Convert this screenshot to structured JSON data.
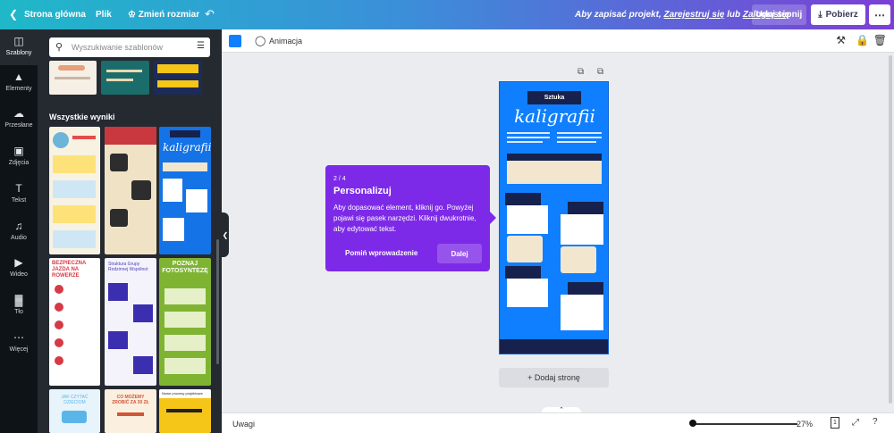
{
  "topbar": {
    "home": "Strona główna",
    "file": "Plik",
    "resize": "Zmień rozmiar",
    "save_prefix": "Aby zapisać projekt,",
    "register": "Zarejestruj się",
    "or": "lub",
    "login": "Zaloguj się",
    "share": "Udostępnij",
    "download": "Pobierz"
  },
  "rail": [
    {
      "label": "Szablony",
      "icon": "templates-icon",
      "active": true
    },
    {
      "label": "Elementy",
      "icon": "elements-icon"
    },
    {
      "label": "Przesłane",
      "icon": "upload-icon"
    },
    {
      "label": "Zdjęcia",
      "icon": "photos-icon"
    },
    {
      "label": "Tekst",
      "icon": "text-icon"
    },
    {
      "label": "Audio",
      "icon": "audio-icon"
    },
    {
      "label": "Wideo",
      "icon": "video-icon"
    },
    {
      "label": "Tło",
      "icon": "background-icon"
    },
    {
      "label": "Więcej",
      "icon": "more-icon"
    }
  ],
  "panel": {
    "search_placeholder": "Wyszukiwanie szablonów",
    "section_title": "Wszystkie wyniki"
  },
  "templates": [
    {
      "title": "BEZPIECZNA JAZDA NA ROWERZE",
      "accent": "#d63a46"
    },
    {
      "title": "Struktura Grupy Rodzinnej Wspólnot",
      "accent": "#4b3fb5"
    },
    {
      "title": "POZNAJ FOTOSYNTEZĘ",
      "accent": "#6aaa2a"
    },
    {
      "title": "JAK CZYTAĆ DZIECIOM",
      "accent": "#5ab6e8"
    },
    {
      "title": "CO MOŻEMY ZROBIĆ ZA 30 ZŁ",
      "accent": "#d0563a"
    },
    {
      "title": "Nowe procesy projektowe",
      "accent": "#f5c518"
    }
  ],
  "editor": {
    "animation": "Animacja",
    "swatch_color": "#0f7fff",
    "add_page": "+ Dodaj stronę",
    "notes": "Uwagi",
    "zoom": "27%",
    "page_count": "1"
  },
  "design": {
    "title_line1": "Sztuka",
    "title_line2": "kaligrafii"
  },
  "tour": {
    "step": "2 / 4",
    "title": "Personalizuj",
    "body": "Aby dopasować element, kliknij go. Powyżej pojawi się pasek narzędzi. Kliknij dwukrotnie, aby edytować tekst.",
    "skip": "Pomiń wprowadzenie",
    "next": "Dalej"
  }
}
